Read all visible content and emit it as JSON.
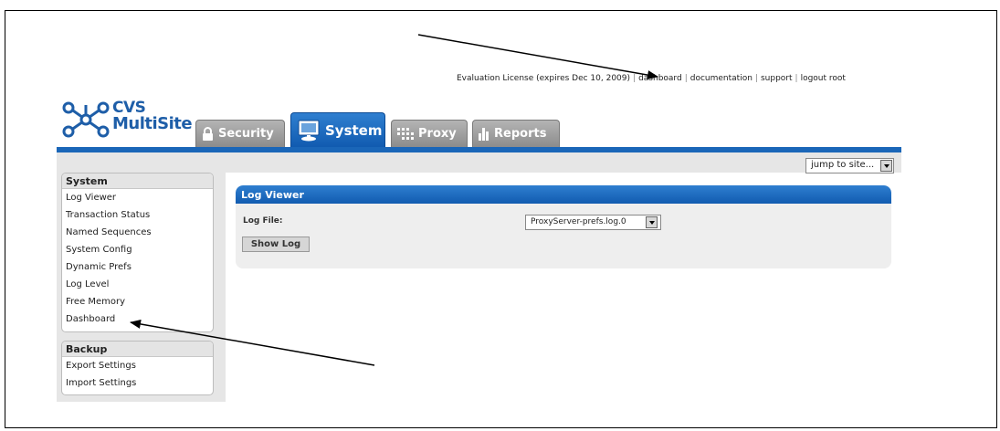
{
  "top_links": {
    "license": "Evaluation License (expires Dec 10, 2009)",
    "dashboard": "dashboard",
    "documentation": "documentation",
    "support": "support",
    "logout": "logout root",
    "separator": "|"
  },
  "logo": {
    "line1": "CVS",
    "line2": "MultiSite"
  },
  "tabs": [
    {
      "label": "Security",
      "icon": "lock-icon"
    },
    {
      "label": "System",
      "icon": "monitor-icon"
    },
    {
      "label": "Proxy",
      "icon": "proxy-icon"
    },
    {
      "label": "Reports",
      "icon": "bar-chart-icon"
    }
  ],
  "jump": {
    "label": "jump to site..."
  },
  "sidebar": {
    "system": {
      "title": "System",
      "items": [
        "Log Viewer",
        "Transaction Status",
        "Named Sequences",
        "System Config",
        "Dynamic Prefs",
        "Log Level",
        "Free Memory",
        "Dashboard"
      ]
    },
    "backup": {
      "title": "Backup",
      "items": [
        "Export Settings",
        "Import Settings"
      ]
    }
  },
  "panel": {
    "title": "Log Viewer",
    "log_file_label": "Log File:",
    "log_file_value": "ProxyServer-prefs.log.0",
    "show_log_button": "Show Log"
  },
  "colors": {
    "brand_blue": "#1a66b8",
    "tab_grey": "#9a9a9a"
  }
}
